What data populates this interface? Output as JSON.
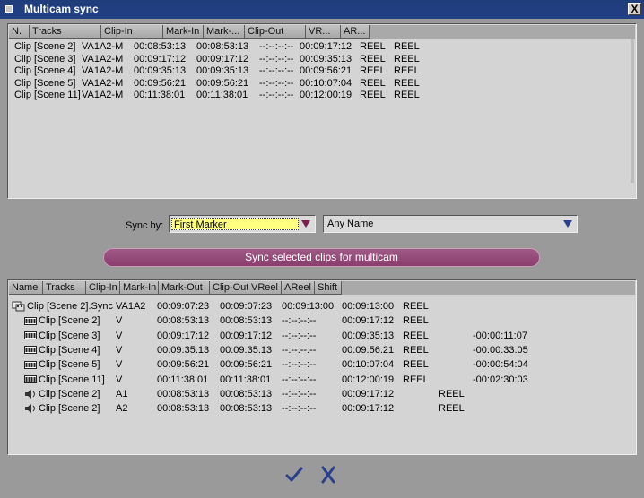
{
  "window": {
    "title": "Multicam sync",
    "close_glyph": "X"
  },
  "top_table": {
    "columns": [
      "N.",
      "Tracks",
      "Clip-In",
      "Mark-In",
      "Mark-...",
      "Clip-Out",
      "VR...",
      "AR..."
    ],
    "rows": [
      [
        "Clip [Scene 2]",
        "VA1A2-M",
        "00:08:53:13",
        "00:08:53:13",
        "--:--:--:--",
        "00:09:17:12",
        "REEL",
        "REEL"
      ],
      [
        "Clip [Scene 3]",
        "VA1A2-M",
        "00:09:17:12",
        "00:09:17:12",
        "--:--:--:--",
        "00:09:35:13",
        "REEL",
        "REEL"
      ],
      [
        "Clip [Scene 4]",
        "VA1A2-M",
        "00:09:35:13",
        "00:09:35:13",
        "--:--:--:--",
        "00:09:56:21",
        "REEL",
        "REEL"
      ],
      [
        "Clip [Scene 5]",
        "VA1A2-M",
        "00:09:56:21",
        "00:09:56:21",
        "--:--:--:--",
        "00:10:07:04",
        "REEL",
        "REEL"
      ],
      [
        "Clip [Scene 11]",
        "VA1A2-M",
        "00:11:38:01",
        "00:11:38:01",
        "--:--:--:--",
        "00:12:00:19",
        "REEL",
        "REEL"
      ]
    ]
  },
  "sync": {
    "label": "Sync by:",
    "mode_value": "First Marker",
    "name_value": "Any Name",
    "button_label": "Sync selected clips for multicam"
  },
  "bottom_table": {
    "columns": [
      "Name",
      "Tracks",
      "Clip-In",
      "Mark-In",
      "Mark-Out",
      "Clip-Out",
      "VReel",
      "AReel",
      "Shift"
    ],
    "rows": [
      {
        "icon": "sequence-icon",
        "name": "Clip [Scene 2].Sync",
        "tracks": "VA1A2",
        "clip_in": "00:09:07:23",
        "mark_in": "00:09:07:23",
        "mark_out": "00:09:13:00",
        "clip_out": "00:09:13:00",
        "vreel": "REEL",
        "areel": "",
        "shift": ""
      },
      {
        "icon": "film-icon",
        "name": "Clip [Scene 2]",
        "tracks": "V",
        "clip_in": "00:08:53:13",
        "mark_in": "00:08:53:13",
        "mark_out": "--:--:--:--",
        "clip_out": "00:09:17:12",
        "vreel": "REEL",
        "areel": "",
        "shift": ""
      },
      {
        "icon": "film-icon",
        "name": "Clip [Scene 3]",
        "tracks": "V",
        "clip_in": "00:09:17:12",
        "mark_in": "00:09:17:12",
        "mark_out": "--:--:--:--",
        "clip_out": "00:09:35:13",
        "vreel": "REEL",
        "areel": "",
        "shift": "-00:00:11:07"
      },
      {
        "icon": "film-icon",
        "name": "Clip [Scene 4]",
        "tracks": "V",
        "clip_in": "00:09:35:13",
        "mark_in": "00:09:35:13",
        "mark_out": "--:--:--:--",
        "clip_out": "00:09:56:21",
        "vreel": "REEL",
        "areel": "",
        "shift": "-00:00:33:05"
      },
      {
        "icon": "film-icon",
        "name": "Clip [Scene 5]",
        "tracks": "V",
        "clip_in": "00:09:56:21",
        "mark_in": "00:09:56:21",
        "mark_out": "--:--:--:--",
        "clip_out": "00:10:07:04",
        "vreel": "REEL",
        "areel": "",
        "shift": "-00:00:54:04"
      },
      {
        "icon": "film-icon",
        "name": "Clip [Scene 11]",
        "tracks": "V",
        "clip_in": "00:11:38:01",
        "mark_in": "00:11:38:01",
        "mark_out": "--:--:--:--",
        "clip_out": "00:12:00:19",
        "vreel": "REEL",
        "areel": "",
        "shift": "-00:02:30:03"
      },
      {
        "icon": "speaker-icon",
        "name": "Clip [Scene 2]",
        "tracks": "A1",
        "clip_in": "00:08:53:13",
        "mark_in": "00:08:53:13",
        "mark_out": "--:--:--:--",
        "clip_out": "00:09:17:12",
        "vreel": "",
        "areel": "REEL",
        "shift": ""
      },
      {
        "icon": "speaker-icon",
        "name": "Clip [Scene 2]",
        "tracks": "A2",
        "clip_in": "00:08:53:13",
        "mark_in": "00:08:53:13",
        "mark_out": "--:--:--:--",
        "clip_out": "00:09:17:12",
        "vreel": "",
        "areel": "REEL",
        "shift": ""
      }
    ]
  },
  "colors": {
    "title_bar": "#233f86",
    "button": "#8a3d6e",
    "highlight": "#ffff80"
  }
}
